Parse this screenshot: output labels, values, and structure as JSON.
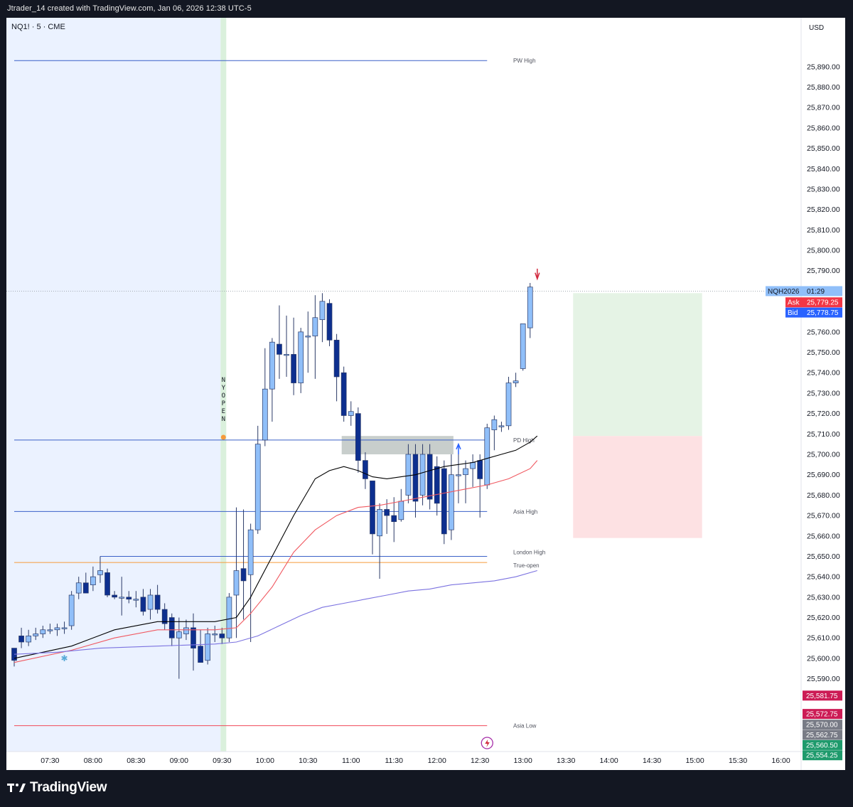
{
  "header": {
    "caption": "Jtrader_14 created with TradingView.com, Jan 06, 2026 12:38 UTC-5"
  },
  "footer": {
    "brand": "TradingView"
  },
  "colors": {
    "bull_fill": "#90bff9",
    "bear_fill": "#0d2f8f",
    "candle_border": "#2b3a67",
    "ema_black": "#000000",
    "ema_red": "#f05860",
    "ema_blue": "#7b72e0",
    "pre_market_shade": "#ebf2ff",
    "open_marker": "#daf0dc",
    "zone_fill": "#aab4b0",
    "target_zone": "#e5f3e5",
    "stop_zone": "#fde1e3",
    "ask_red": "#f23645",
    "bid_blue": "#2962ff"
  },
  "chart_data": {
    "type": "candlestick",
    "symbol": "NQ1! · 5 · CME",
    "currency": "USD",
    "ylim": [
      25545,
      25900
    ],
    "y_ticks": [
      25590,
      25600,
      25610,
      25620,
      25630,
      25640,
      25650,
      25660,
      25670,
      25680,
      25690,
      25700,
      25710,
      25720,
      25730,
      25740,
      25750,
      25760,
      25770,
      25780,
      25790,
      25800,
      25810,
      25820,
      25830,
      25840,
      25850,
      25860,
      25870,
      25880,
      25890
    ],
    "x_labels": [
      {
        "t": "07:30",
        "i": 5
      },
      {
        "t": "08:00",
        "i": 11
      },
      {
        "t": "08:30",
        "i": 17
      },
      {
        "t": "09:00",
        "i": 23
      },
      {
        "t": "09:30",
        "i": 29
      },
      {
        "t": "10:00",
        "i": 35
      },
      {
        "t": "10:30",
        "i": 41
      },
      {
        "t": "11:00",
        "i": 47
      },
      {
        "t": "11:30",
        "i": 53
      },
      {
        "t": "12:00",
        "i": 59
      },
      {
        "t": "12:30",
        "i": 65
      },
      {
        "t": "13:00",
        "i": 71
      },
      {
        "t": "13:30",
        "i": 77
      },
      {
        "t": "14:00",
        "i": 83
      },
      {
        "t": "14:30",
        "i": 89
      },
      {
        "t": "15:00",
        "i": 95
      },
      {
        "t": "15:30",
        "i": 101
      },
      {
        "t": "16:00",
        "i": 107
      }
    ],
    "candles": [
      [
        25605,
        25603,
        25596,
        25599
      ],
      [
        25611,
        25615,
        25605,
        25608
      ],
      [
        25608,
        25614,
        25606,
        25611
      ],
      [
        25611,
        25615,
        25609,
        25612
      ],
      [
        25612,
        25616,
        25610,
        25614
      ],
      [
        25614,
        25617,
        25612,
        25614
      ],
      [
        25614,
        25617,
        25611,
        25615
      ],
      [
        25615,
        25618,
        25612,
        25615
      ],
      [
        25616,
        25633,
        25614,
        25631
      ],
      [
        25632,
        25640,
        25629,
        25637
      ],
      [
        25637,
        25642,
        25632,
        25632
      ],
      [
        25636,
        25645,
        25633,
        25640
      ],
      [
        25641,
        25650,
        25637,
        25643
      ],
      [
        25642,
        25644,
        25630,
        25631
      ],
      [
        25631,
        25633,
        25629,
        25630
      ],
      [
        25630,
        25640,
        25621,
        25630
      ],
      [
        25630,
        25633,
        25627,
        25629
      ],
      [
        25629,
        25633,
        25625,
        25629
      ],
      [
        25630,
        25634,
        25621,
        25623
      ],
      [
        25624,
        25634,
        25619,
        25631
      ],
      [
        25631,
        25636,
        25622,
        25624
      ],
      [
        25624,
        25627,
        25614,
        25617
      ],
      [
        25620,
        25622,
        25606,
        25610
      ],
      [
        25610,
        25620,
        25590,
        25613
      ],
      [
        25612,
        25619,
        25609,
        25615
      ],
      [
        25615,
        25622,
        25594,
        25605
      ],
      [
        25606,
        25614,
        25599,
        25598
      ],
      [
        25599,
        25615,
        25597,
        25612
      ],
      [
        25612,
        25616,
        25608,
        25612
      ],
      [
        25612,
        25615,
        25607,
        25610
      ],
      [
        25610,
        25632,
        25608,
        25630
      ],
      [
        25631,
        25674,
        25610,
        25643
      ],
      [
        25644,
        25673,
        25619,
        25638
      ],
      [
        25641,
        25666,
        25608,
        25663
      ],
      [
        25663,
        25714,
        25661,
        25705
      ],
      [
        25707,
        25752,
        25704,
        25732
      ],
      [
        25732,
        25757,
        25716,
        25755
      ],
      [
        25754,
        25773,
        25737,
        25749
      ],
      [
        25749,
        25768,
        25738,
        25749
      ],
      [
        25749,
        25767,
        25729,
        25735
      ],
      [
        25735,
        25762,
        25730,
        25760
      ],
      [
        25758,
        25770,
        25740,
        25758
      ],
      [
        25758,
        25778,
        25737,
        25767
      ],
      [
        25766,
        25779,
        25755,
        25775
      ],
      [
        25774,
        25776,
        25753,
        25756
      ],
      [
        25756,
        25759,
        25726,
        25738
      ],
      [
        25740,
        25743,
        25716,
        25719
      ],
      [
        25719,
        25726,
        25714,
        25721
      ],
      [
        25720,
        25723,
        25691,
        25697
      ],
      [
        25697,
        25701,
        25683,
        25688
      ],
      [
        25687,
        25687,
        25651,
        25661
      ],
      [
        25660,
        25676,
        25639,
        25673
      ],
      [
        25673,
        25678,
        25661,
        25670
      ],
      [
        25670,
        25679,
        25657,
        25667
      ],
      [
        25668,
        25683,
        25667,
        25677
      ],
      [
        25680,
        25705,
        25676,
        25700
      ],
      [
        25700,
        25705,
        25669,
        25677
      ],
      [
        25680,
        25705,
        25675,
        25700
      ],
      [
        25700,
        25705,
        25673,
        25678
      ],
      [
        25694,
        25699,
        25670,
        25676
      ],
      [
        25693,
        25697,
        25656,
        25661
      ],
      [
        25663,
        25700,
        25658,
        25690
      ],
      [
        25690,
        25700,
        25676,
        25690
      ],
      [
        25690,
        25697,
        25676,
        25693
      ],
      [
        25693,
        25700,
        25684,
        25696
      ],
      [
        25697,
        25700,
        25669,
        25688
      ],
      [
        25685,
        25715,
        25683,
        25713
      ],
      [
        25712,
        25719,
        25702,
        25717
      ],
      [
        25714,
        25716,
        25711,
        25714
      ],
      [
        25714,
        25738,
        25712,
        25735
      ],
      [
        25735,
        25740,
        25733,
        25736
      ],
      [
        25742,
        25764,
        25741,
        25764
      ],
      [
        25762,
        25784,
        25757,
        25782
      ]
    ],
    "emas": [
      {
        "color": "#000000",
        "points": [
          [
            0,
            25600
          ],
          [
            8,
            25606
          ],
          [
            14,
            25614
          ],
          [
            20,
            25618
          ],
          [
            28,
            25618
          ],
          [
            31,
            25620
          ],
          [
            33,
            25630
          ],
          [
            36,
            25650
          ],
          [
            39,
            25670
          ],
          [
            42,
            25688
          ],
          [
            44,
            25692
          ],
          [
            46,
            25694
          ],
          [
            48,
            25692
          ],
          [
            50,
            25689
          ],
          [
            52,
            25688
          ],
          [
            54,
            25689
          ],
          [
            56,
            25690
          ],
          [
            58,
            25692
          ],
          [
            60,
            25694
          ],
          [
            62,
            25695
          ],
          [
            64,
            25696
          ],
          [
            66,
            25698
          ],
          [
            68,
            25700
          ],
          [
            70,
            25702
          ],
          [
            72,
            25706
          ],
          [
            73,
            25709
          ]
        ]
      },
      {
        "color": "#f05860",
        "points": [
          [
            0,
            25598
          ],
          [
            8,
            25604
          ],
          [
            14,
            25610
          ],
          [
            20,
            25614
          ],
          [
            28,
            25614
          ],
          [
            31,
            25615
          ],
          [
            33,
            25622
          ],
          [
            36,
            25635
          ],
          [
            39,
            25652
          ],
          [
            42,
            25663
          ],
          [
            45,
            25670
          ],
          [
            48,
            25674
          ],
          [
            51,
            25675
          ],
          [
            54,
            25677
          ],
          [
            57,
            25679
          ],
          [
            60,
            25681
          ],
          [
            63,
            25683
          ],
          [
            66,
            25685
          ],
          [
            69,
            25688
          ],
          [
            72,
            25693
          ],
          [
            73,
            25697
          ]
        ]
      },
      {
        "color": "#7b72e0",
        "points": [
          [
            0,
            25602
          ],
          [
            6,
            25603
          ],
          [
            12,
            25605
          ],
          [
            20,
            25606
          ],
          [
            28,
            25607
          ],
          [
            31,
            25608
          ],
          [
            34,
            25611
          ],
          [
            37,
            25616
          ],
          [
            40,
            25621
          ],
          [
            43,
            25625
          ],
          [
            46,
            25627
          ],
          [
            49,
            25629
          ],
          [
            52,
            25631
          ],
          [
            55,
            25633
          ],
          [
            58,
            25634
          ],
          [
            61,
            25636
          ],
          [
            64,
            25637
          ],
          [
            67,
            25638
          ],
          [
            70,
            25640
          ],
          [
            73,
            25643
          ]
        ]
      }
    ],
    "levels": [
      {
        "label": "PW High",
        "price": 25893,
        "color": "#3a60c8",
        "from": 0
      },
      {
        "label": "PD High",
        "price": 25707,
        "color": "#3a60c8",
        "from": 0
      },
      {
        "label": "Asia High",
        "price": 25672,
        "color": "#3a60c8",
        "from": 0
      },
      {
        "label": "London High",
        "price": 25650,
        "color": "#3a60c8",
        "from": 12
      },
      {
        "label": "True-open",
        "price": 25647,
        "color": "#f59a3b",
        "from": 0
      },
      {
        "label": "Asia Low",
        "price": 25567,
        "color": "#f04a5a",
        "from": 0
      }
    ],
    "zone": {
      "i0": 46,
      "i1": 61,
      "top": 25709,
      "bottom": 25700
    },
    "position": {
      "i0": 78,
      "i1": 96,
      "top": 25779,
      "entry": 25709,
      "bottom": 25659
    },
    "session_label": "NY OPEN",
    "price_tags": [
      {
        "label": "NQH2026",
        "value": "01:29",
        "price": 25780,
        "bg": "#90bff9",
        "fg": "#131722"
      },
      {
        "label": "Ask",
        "value": "25,779.25",
        "price": 25774.5,
        "bg": "#f23645",
        "fg": "#ffffff"
      },
      {
        "label": "Bid",
        "value": "25,778.75",
        "price": 25769.5,
        "bg": "#2962ff",
        "fg": "#ffffff"
      }
    ],
    "side_tags": [
      {
        "value": "25,581.75",
        "price": 25581.75,
        "bg": "#cc1b55"
      },
      {
        "value": "25,572.75",
        "price": 25572.75,
        "bg": "#cc1b55"
      },
      {
        "value": "25,570.00",
        "price": 25567.5,
        "bg": "#787b86"
      },
      {
        "value": "25,562.75",
        "price": 25562.5,
        "bg": "#787b86"
      },
      {
        "value": "25,560.50",
        "price": 25557.5,
        "bg": "#1e9a6c"
      },
      {
        "value": "25,554.25",
        "price": 25552.5,
        "bg": "#1e9a6c"
      }
    ],
    "sell_arrow_index": 73,
    "buy_arrow_index": 62
  }
}
